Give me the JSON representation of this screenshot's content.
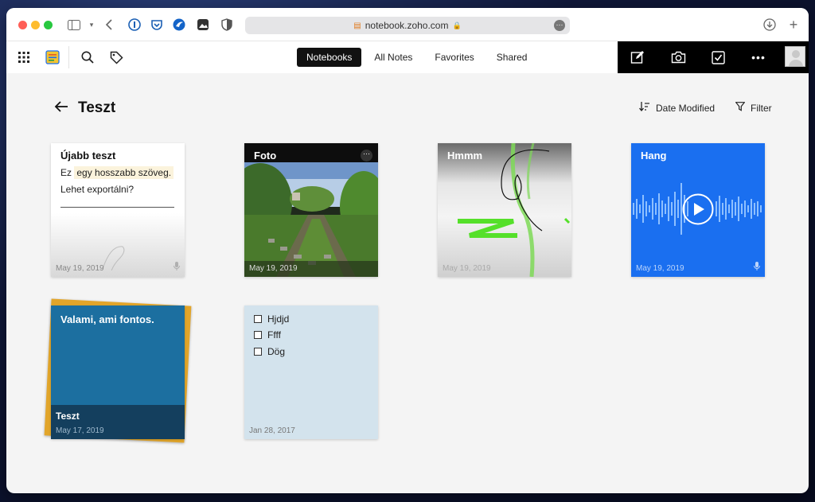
{
  "browser": {
    "url": "notebook.zoho.com"
  },
  "header": {
    "tabs": [
      {
        "label": "Notebooks",
        "active": true
      },
      {
        "label": "All Notes",
        "active": false
      },
      {
        "label": "Favorites",
        "active": false
      },
      {
        "label": "Shared",
        "active": false
      }
    ]
  },
  "page": {
    "title": "Teszt",
    "sort_label": "Date Modified",
    "filter_label": "Filter"
  },
  "cards": [
    {
      "title": "Újabb teszt",
      "line1_a": "Ez",
      "line1_b": "egy hosszabb szöveg.",
      "line2": "Lehet exportálni?",
      "date": "May 19, 2019",
      "type": "text"
    },
    {
      "title": "Foto",
      "date": "May 19, 2019",
      "type": "photo"
    },
    {
      "title": "Hmmm",
      "date": "May 19, 2019",
      "type": "sketch"
    },
    {
      "title": "Hang",
      "date": "May 19, 2019",
      "type": "audio"
    },
    {
      "title": "Valami, ami fontos.",
      "subtitle": "Teszt",
      "date": "May 17, 2019",
      "type": "text",
      "color": "#1c6fa0"
    },
    {
      "items": [
        "Hjdjd",
        "Ffff",
        "Dög"
      ],
      "date": "Jan 28, 2017",
      "type": "checklist",
      "color": "#d3e3ed"
    }
  ],
  "colors": {
    "audio_card": "#1a6ff0",
    "stack_back": "#e2a52a"
  }
}
